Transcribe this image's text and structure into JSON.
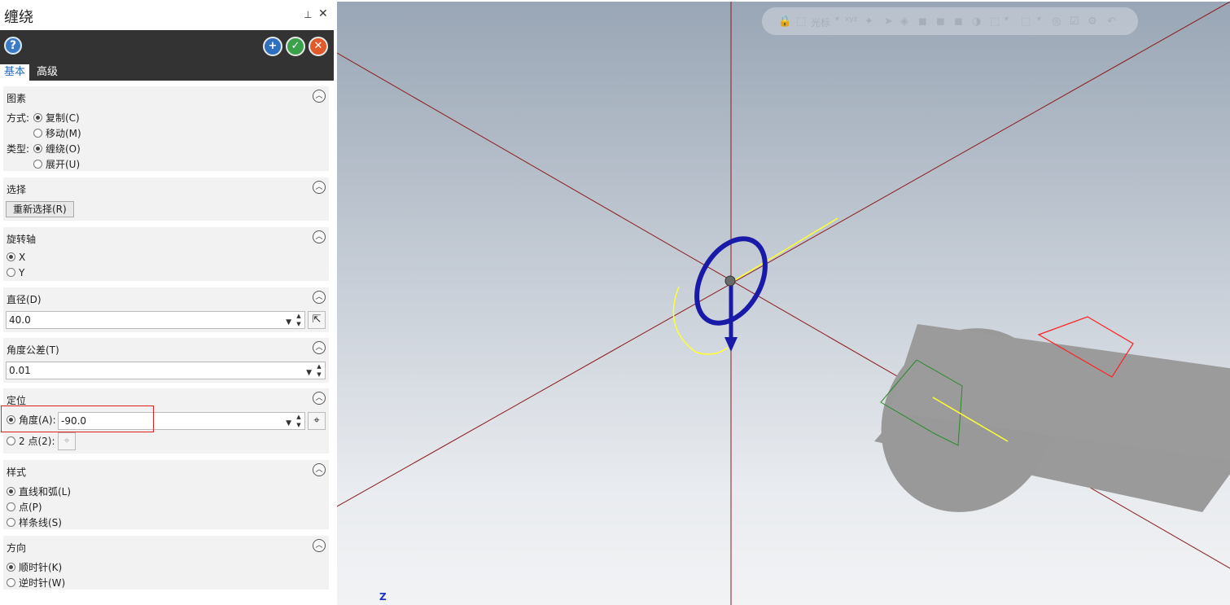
{
  "panel": {
    "title": "缠绕",
    "pin_icon": "pin-icon",
    "close_icon": "close-icon",
    "help_icon": "help-icon",
    "actions": [
      "apply-and-new-icon",
      "ok-icon",
      "cancel-icon"
    ],
    "tabs": [
      {
        "label": "基本",
        "active": true
      },
      {
        "label": "高级",
        "active": false
      }
    ],
    "elements": {
      "header": "图素",
      "method_label": "方式:",
      "method_options": [
        {
          "label": "复制(C)",
          "checked": true
        },
        {
          "label": "移动(M)",
          "checked": false
        }
      ],
      "type_label": "类型:",
      "type_options": [
        {
          "label": "缠绕(O)",
          "checked": true
        },
        {
          "label": "展开(U)",
          "checked": false
        }
      ]
    },
    "select": {
      "header": "选择",
      "reselect_button": "重新选择(R)"
    },
    "axis": {
      "header": "旋转轴",
      "options": [
        {
          "label": "X",
          "checked": true
        },
        {
          "label": "Y",
          "checked": false
        }
      ]
    },
    "diameter": {
      "header": "直径(D)",
      "value": "40.0"
    },
    "tolerance": {
      "header": "角度公差(T)",
      "value": "0.01"
    },
    "position": {
      "header": "定位",
      "angle_label": "角度(A):",
      "angle_value": "-90.0",
      "angle_checked": true,
      "two_point_label": "2 点(2):",
      "two_point_checked": false
    },
    "style": {
      "header": "样式",
      "options": [
        {
          "label": "直线和弧(L)",
          "checked": true
        },
        {
          "label": "点(P)",
          "checked": false
        },
        {
          "label": "样条线(S)",
          "checked": false
        }
      ]
    },
    "direction": {
      "header": "方向",
      "options": [
        {
          "label": "顺时针(K)",
          "checked": true
        },
        {
          "label": "逆时针(W)",
          "checked": false
        }
      ]
    }
  },
  "viewport": {
    "toolbar_label": "光标",
    "axis_label": "Z",
    "colors": {
      "axis_lines": "#8b1a1a",
      "gizmo": "#1a1aa8",
      "wrap_curve": "#ffff33",
      "cylinder": "#9a9a9a",
      "red_outline": "#ff2020",
      "green_outline": "#2a8a2a"
    }
  }
}
